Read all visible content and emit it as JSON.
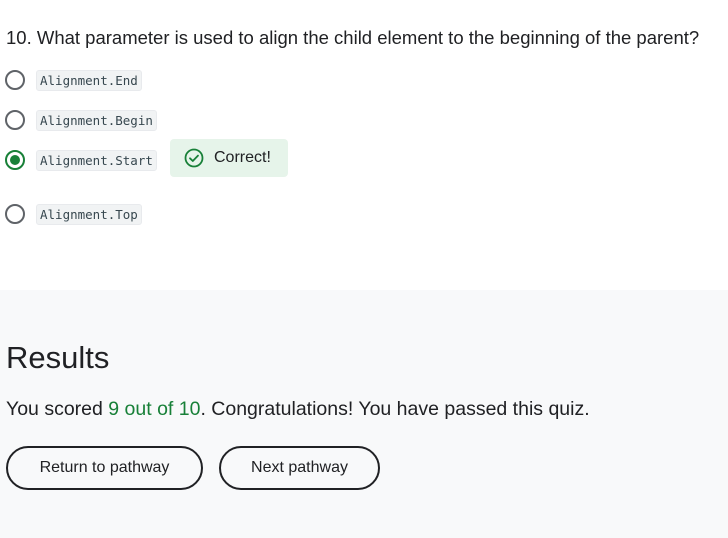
{
  "question": {
    "number": "10.",
    "text": "What parameter is used to align the child element to the beginning of the parent?",
    "options": [
      {
        "label": "Alignment.End",
        "selected": false
      },
      {
        "label": "Alignment.Begin",
        "selected": false
      },
      {
        "label": "Alignment.Start",
        "selected": true
      },
      {
        "label": "Alignment.Top",
        "selected": false
      }
    ],
    "feedback": {
      "text": "Correct!",
      "icon": "check-circle-icon",
      "color": "#188038",
      "background": "#e6f4ea"
    }
  },
  "results": {
    "title": "Results",
    "score_prefix": "You scored ",
    "score_value": "9 out of 10",
    "score_suffix": ". Congratulations! You have passed this quiz.",
    "buttons": {
      "return_label": "Return to pathway",
      "next_label": "Next pathway"
    }
  },
  "colors": {
    "accent_green": "#188038",
    "results_background": "#f8f9fa"
  }
}
